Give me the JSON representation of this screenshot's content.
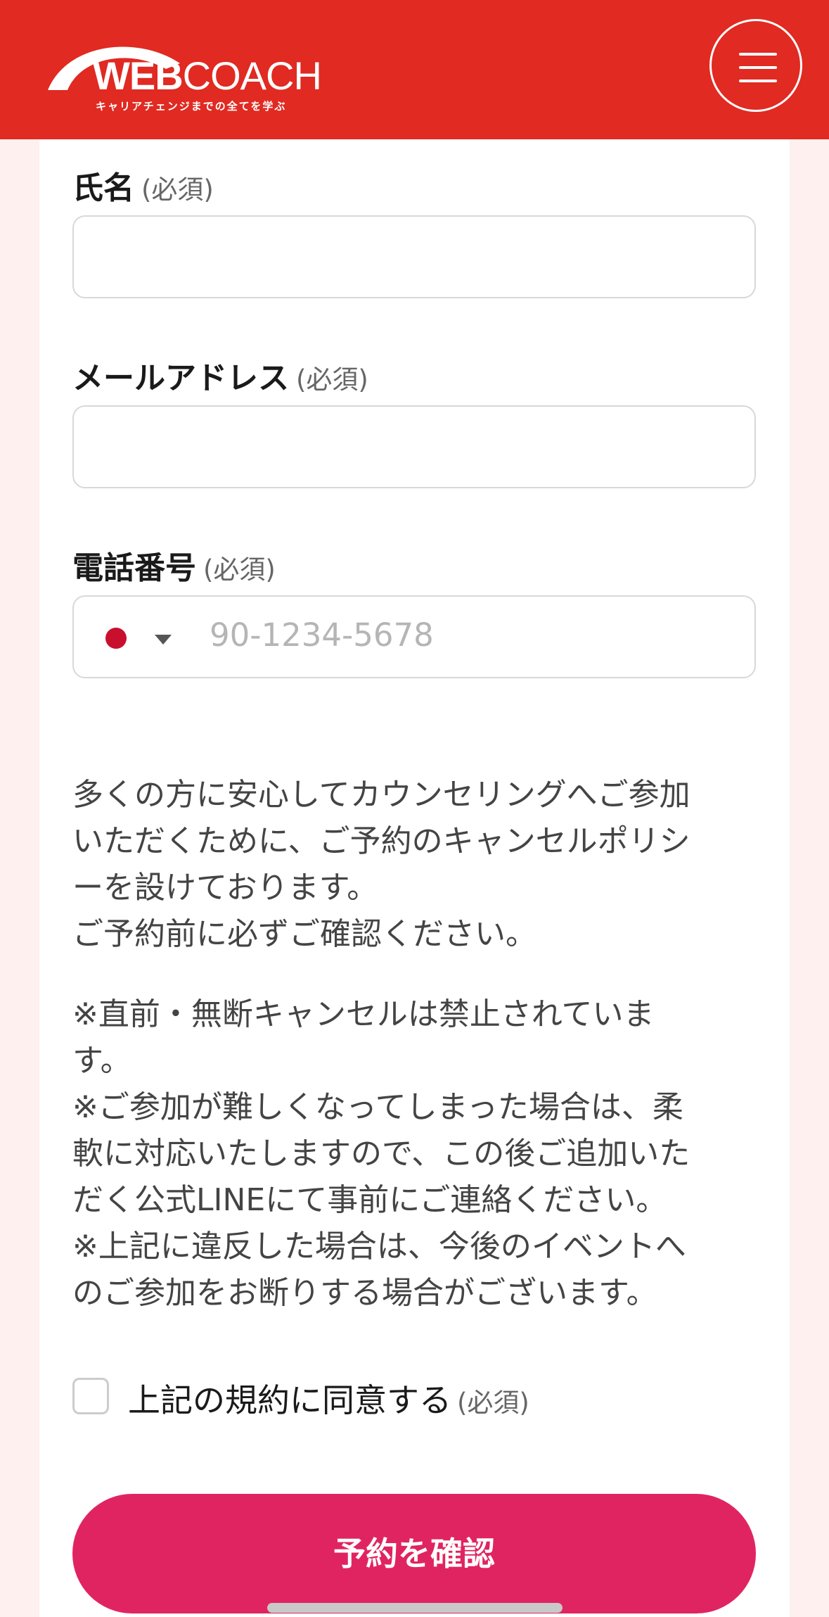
{
  "header": {
    "logo_web": "WEB",
    "logo_coach": "COACH",
    "logo_tagline": "キャリアチェンジまでの全てを学ぶ",
    "brand_color": "#e02a22"
  },
  "form": {
    "name_label": "氏名",
    "email_label": "メールアドレス",
    "phone_label": "電話番号",
    "required_text": "(必須)",
    "name_value": "",
    "email_value": "",
    "phone_placeholder": "90-1234-5678",
    "country_flag": "japan-flag"
  },
  "policy": {
    "intro_lines": [
      "多くの方に安心してカウンセリングへご参加",
      "いただくために、ご予約のキャンセルポリシ",
      "ーを設けております。",
      "ご予約前に必ずご確認ください。"
    ],
    "notes_lines": [
      "※直前・無断キャンセルは禁止されていま",
      "す。",
      "※ご参加が難しくなってしまった場合は、柔",
      "軟に対応いたしますので、この後ご追加いた",
      "だく公式LINEにて事前にご連絡ください。",
      "※上記に違反した場合は、今後のイベントへ",
      "のご参加をお断りする場合がございます。"
    ]
  },
  "agreement": {
    "label": "上記の規約に同意する",
    "required_text": "(必須)",
    "checked": false
  },
  "submit": {
    "label": "予約を確認",
    "color": "#e02462"
  }
}
